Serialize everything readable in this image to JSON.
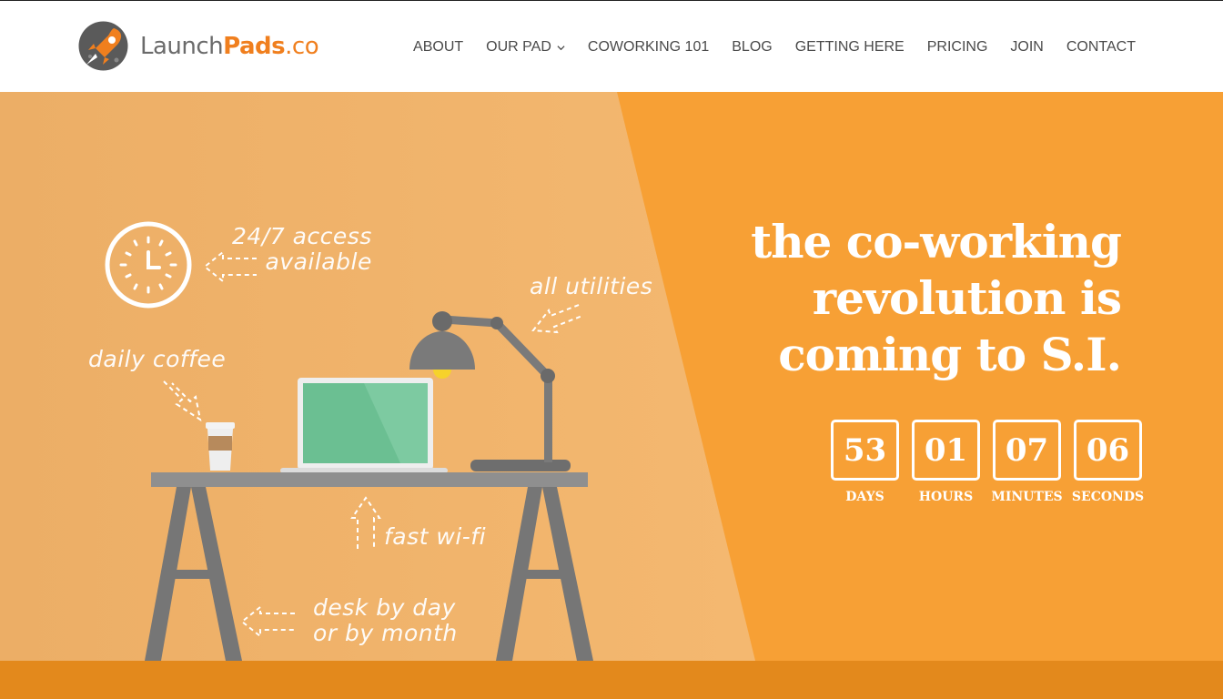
{
  "brand": {
    "name_part1": "Launch",
    "name_part2": "Pads",
    "name_part3": ".co",
    "accent": "#f07f1e"
  },
  "nav": {
    "items": [
      {
        "label": "ABOUT"
      },
      {
        "label": "OUR PAD",
        "dropdown": true
      },
      {
        "label": "COWORKING 101"
      },
      {
        "label": "BLOG"
      },
      {
        "label": "GETTING HERE"
      },
      {
        "label": "PRICING"
      },
      {
        "label": "JOIN"
      },
      {
        "label": "CONTACT"
      }
    ]
  },
  "hero": {
    "headline": {
      "line1_light": "the ",
      "line1_bold": "co-working",
      "line2_bold": "revolution is",
      "line3_light": "coming to S.I."
    },
    "countdown": [
      {
        "value": "53",
        "label": "DAYS"
      },
      {
        "value": "01",
        "label": "HOURS"
      },
      {
        "value": "07",
        "label": "MINUTES"
      },
      {
        "value": "06",
        "label": "SECONDS"
      }
    ],
    "notes": {
      "access_line1": "24/7 access",
      "access_line2": "available",
      "utilities": "all utilities",
      "coffee": "daily coffee",
      "wifi": "fast wi-fi",
      "desk_line1": "desk by day",
      "desk_line2": "or by month"
    },
    "colors": {
      "left_panel": "#f2b56e",
      "right_panel": "#f7a035",
      "bottom_strip": "#e3891c"
    }
  }
}
